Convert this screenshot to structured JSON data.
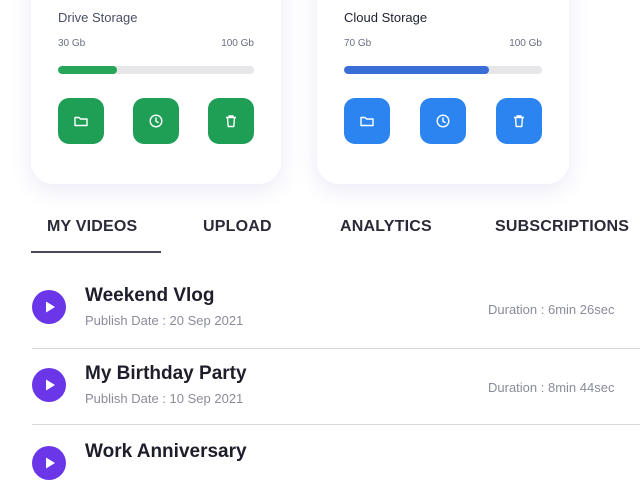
{
  "storage_cards": [
    {
      "title": "Drive Storage",
      "used": "30 Gb",
      "total": "100 Gb",
      "usage_fraction": 0.3,
      "accent": "#1f9e55"
    },
    {
      "title": "Cloud Storage",
      "used": "70 Gb",
      "total": "100 Gb",
      "usage_fraction": 0.73,
      "accent": "#2b84f0"
    }
  ],
  "card_actions": [
    "folder-icon",
    "clock-icon",
    "trash-icon"
  ],
  "tabs": [
    {
      "label": "MY VIDEOS",
      "active": true
    },
    {
      "label": "UPLOAD",
      "active": false
    },
    {
      "label": "ANALYTICS",
      "active": false
    },
    {
      "label": "SUBSCRIPTIONS",
      "active": false
    }
  ],
  "videos": [
    {
      "title": "Weekend Vlog",
      "publish": "Publish Date : 20 Sep 2021",
      "duration": "Duration : 6min 26sec"
    },
    {
      "title": "My Birthday Party",
      "publish": "Publish Date : 10 Sep 2021",
      "duration": "Duration : 8min 44sec"
    },
    {
      "title": "Work Anniversary",
      "publish": "",
      "duration": ""
    }
  ],
  "colors": {
    "play_button": "#6b36e8",
    "drive_bar": "#27a55a",
    "cloud_bar": "#3a6ed6"
  }
}
